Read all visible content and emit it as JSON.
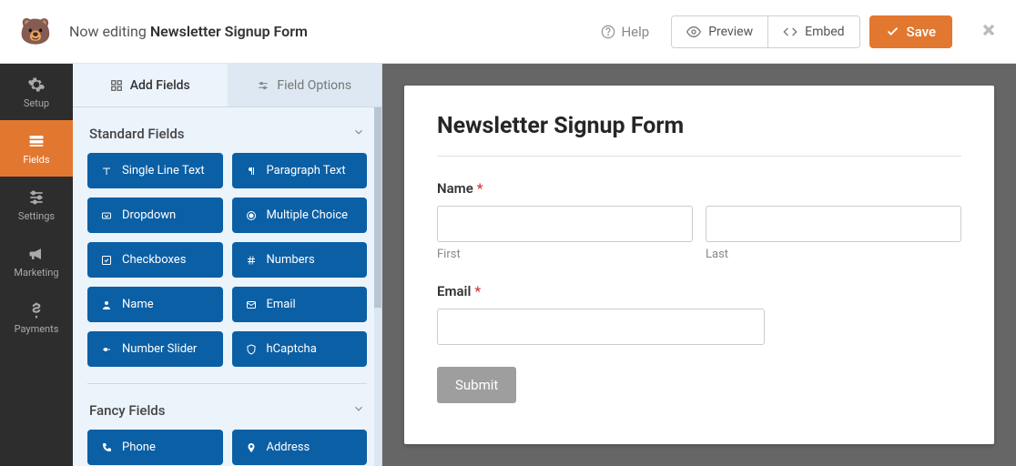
{
  "top": {
    "now_editing": "Now editing",
    "form_name": "Newsletter Signup Form",
    "help": "Help",
    "preview": "Preview",
    "embed": "Embed",
    "save": "Save"
  },
  "nav": [
    {
      "key": "setup",
      "label": "Setup",
      "icon": "gear-icon"
    },
    {
      "key": "fields",
      "label": "Fields",
      "icon": "fields-icon",
      "active": true
    },
    {
      "key": "settings",
      "label": "Settings",
      "icon": "sliders-icon"
    },
    {
      "key": "marketing",
      "label": "Marketing",
      "icon": "bullhorn-icon"
    },
    {
      "key": "payments",
      "label": "Payments",
      "icon": "dollar-icon"
    }
  ],
  "sidebar": {
    "tabs": {
      "add": "Add Fields",
      "options": "Field Options"
    },
    "sections": [
      {
        "title": "Standard Fields",
        "fields": [
          {
            "label": "Single Line Text",
            "icon": "text-icon"
          },
          {
            "label": "Paragraph Text",
            "icon": "paragraph-icon"
          },
          {
            "label": "Dropdown",
            "icon": "dropdown-icon"
          },
          {
            "label": "Multiple Choice",
            "icon": "radio-icon"
          },
          {
            "label": "Checkboxes",
            "icon": "checkbox-icon"
          },
          {
            "label": "Numbers",
            "icon": "hash-icon"
          },
          {
            "label": "Name",
            "icon": "user-icon"
          },
          {
            "label": "Email",
            "icon": "envelope-icon"
          },
          {
            "label": "Number Slider",
            "icon": "slider-icon"
          },
          {
            "label": "hCaptcha",
            "icon": "shield-icon"
          }
        ]
      },
      {
        "title": "Fancy Fields",
        "fields": [
          {
            "label": "Phone",
            "icon": "phone-icon"
          },
          {
            "label": "Address",
            "icon": "pin-icon"
          }
        ]
      }
    ]
  },
  "form": {
    "title": "Newsletter Signup Form",
    "name_label": "Name",
    "first_label": "First",
    "last_label": "Last",
    "email_label": "Email",
    "submit": "Submit"
  }
}
